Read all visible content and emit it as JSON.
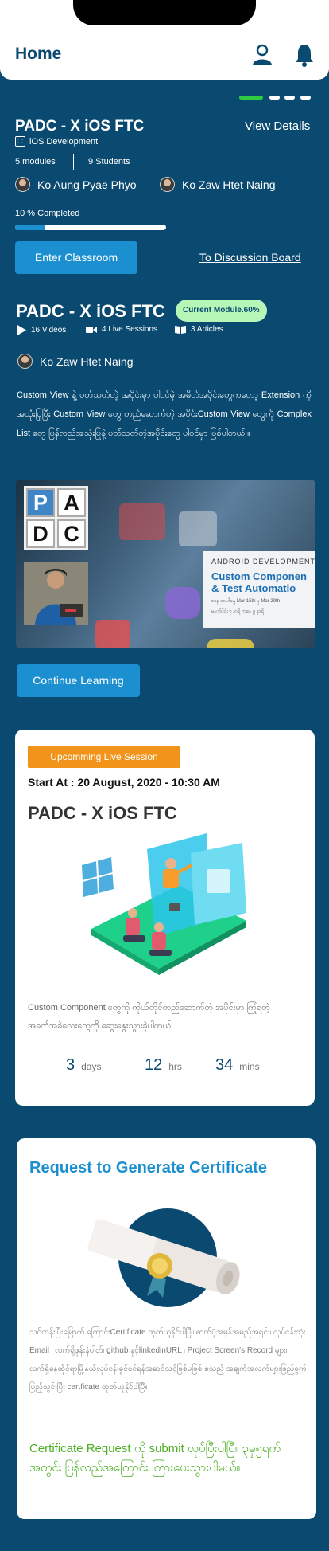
{
  "header": {
    "title": "Home",
    "profile_icon": "person-icon",
    "notification_icon": "bell-icon"
  },
  "pager": {
    "count": 4,
    "active_index": 0,
    "active_color": "#2ecc40"
  },
  "course": {
    "title": "PADC - X iOS FTC",
    "view_details": "View Details",
    "subject": "iOS Development",
    "modules": "5 modules",
    "students": "9 Students",
    "teachers": [
      "Ko Aung Pyae Phyo",
      "Ko Zaw Htet Naing"
    ],
    "completed_label": "10 % Completed",
    "progress_fraction": 0.2,
    "enter_button": "Enter Classroom",
    "discussion_link": "To Discussion Board"
  },
  "module": {
    "title": "PADC - X iOS FTC",
    "badge": "Current Module.60%",
    "videos": "16 Videos",
    "live_sessions": "4 Live Sessions",
    "articles": "3 Articles",
    "teacher": "Ko Zaw Htet Naing",
    "description": "Custom View နဲ့ ပတ်သတ်တဲ့ အပိုင်းမှာ ပါဝင်မဲ့ အဓိတ်အပိုင်းတွေကတော့ Extension ကို အသုံးပြုပြီး Custom View တွေ တည်ဆောက်တဲ့ အပိုင်းCustom View တွေကို Complex List တွေ ပြန်လည်အသုံးပြုနဲ့ ပတ်သတ်တဲ့အပိုင်းတွေ ပါဝင်မှာ ဖြစ်ပါတယ် ။",
    "thumbnail": {
      "logo_letters": [
        "P",
        "A",
        "D",
        "C"
      ],
      "card_kicker": "ANDROID DEVELOPMENT",
      "card_title_1": "Custom Componen",
      "card_title_2": "& Test Automatio",
      "card_sub_1": "စနေ တနင်္ဂနွေ Mar 15th မှ Mar 29th",
      "card_sub_2": "မနက်ပိုင်း ၇ နာရီ ကနေ ၉ နာရီ"
    },
    "continue_button": "Continue Learning"
  },
  "live_session": {
    "badge": "Upcomming Live Session",
    "start_at": "Start At : 20 August, 2020 - 10:30 AM",
    "title": "PADC - X iOS FTC",
    "description": "Custom Component တွေကို ကိုယ်တိုင်တည်ဆောက်တဲ့ အပိုင်းမှာ ကြုံရတဲ့ အခက်အခဲလေးတွေကို ဆွေးနွေးသွားခဲ့ပါတယ်",
    "countdown": [
      {
        "value": "3",
        "unit": "days"
      },
      {
        "value": "12",
        "unit": "hrs"
      },
      {
        "value": "34",
        "unit": "mins"
      }
    ]
  },
  "certificate": {
    "title": "Request to Generate Certificate",
    "description": "သင်တန်းပြီးမြောက် ကြောင်းCertificate ထုတ်ယူနိုင်ပါပြီ။ ဓာတ်ပုံအမှန်အမည်အရင်း၊ လုပ်ငန်းသုံး Email ၊ လက်ရှိဖုန်းနံပါတ်၊ github နှင့်linkedinURL ၊ Project Screen's Record များ၊ လက်ရှိနေထိုင်ရာမြို့နယ်လုပ်ငန်းခွင်ဝင်ရန်အဆင်သင့်ဖြစ်မဖြစ် စသည့် အချက်အလက်များဖြည့်စွက်ပြည့်သွင်းပြီး certficate ထုတ်ယူနိုင်ပါပြီ။",
    "note": "Certificate Request ကို submit လုပ်ပြီးပါပြီ။ ၃မှ၅ရက်အတွင်း ပြန်လည်အကြောင်း ကြားပေးသွားပါမယ်။"
  },
  "colors": {
    "background": "#0b4a70",
    "accent": "#1c8fd0",
    "badge_green": "#b6f7b8",
    "live_orange": "#f2931a",
    "note_green": "#4caf22"
  }
}
